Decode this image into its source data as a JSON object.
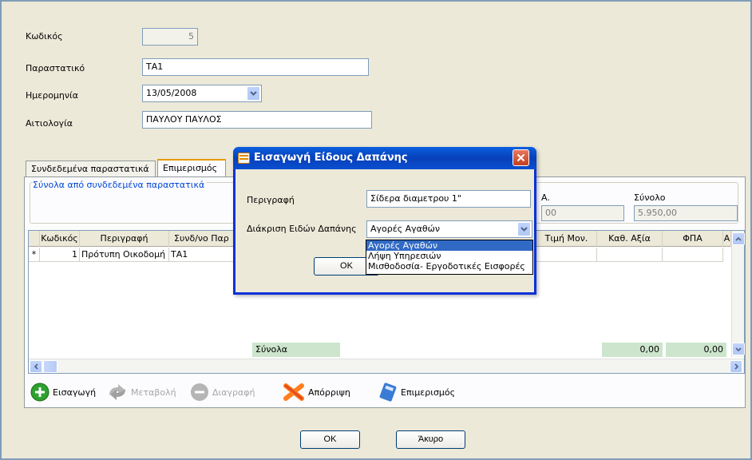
{
  "form": {
    "code_label": "Κωδικός",
    "code_value": "5",
    "doc_label": "Παραστατικό",
    "doc_value": "ΤΑ1",
    "date_label": "Ημερομηνία",
    "date_value": "13/05/2008",
    "reason_label": "Αιτιολογία",
    "reason_value": "ΠΑΥΛΟΥ ΠΑΥΛΟΣ"
  },
  "tabs": [
    {
      "label": "Συνδεδεμένα παραστατικά"
    },
    {
      "label": "Επιμερισμός"
    }
  ],
  "summary": {
    "group_title": "Σύνολα από συνδεδεμένα παραστατικά",
    "col_partial_label": "Α.",
    "col_partial_value": "00",
    "total_label": "Σύνολο",
    "total_value": "5.950,00"
  },
  "grid": {
    "headers": [
      "Κωδικός",
      "Περιγραφή",
      "Συνδ/νο Παρ",
      "Τιμή Μον.",
      "Καθ. Αξία",
      "ΦΠΑ",
      "Α"
    ],
    "row": {
      "marker": "*",
      "code": "1",
      "description": "Πρότυπη Οικοδομή",
      "doc": "ΤΑ1"
    },
    "totals_label": "Σύνολα",
    "totals_net": "0,00",
    "totals_vat": "0,00"
  },
  "toolbar": {
    "insert": "Εισαγωγή",
    "edit": "Μεταβολή",
    "delete": "Διαγραφή",
    "reject": "Απόρριψη",
    "allocate": "Επιμερισμός"
  },
  "buttons": {
    "ok": "OK",
    "cancel": "Άκυρο"
  },
  "dialog": {
    "title": "Εισαγωγή Είδους Δαπάνης",
    "desc_label": "Περιγραφή",
    "desc_value": "Σίδερα διαμετρου 1\"",
    "category_label": "Διάκριση Ειδών Δαπάνης",
    "category_value": "Αγορές Αγαθών",
    "options": [
      "Αγορές Αγαθών",
      "Λήψη Υπηρεσιών",
      "Μισθοδοσία- Εργοδοτικές Εισφορές"
    ],
    "ok": "OK"
  },
  "colors": {
    "accent": "#0a5fe0",
    "totals_bg": "#cce5cc",
    "selection": "#316ac5"
  }
}
